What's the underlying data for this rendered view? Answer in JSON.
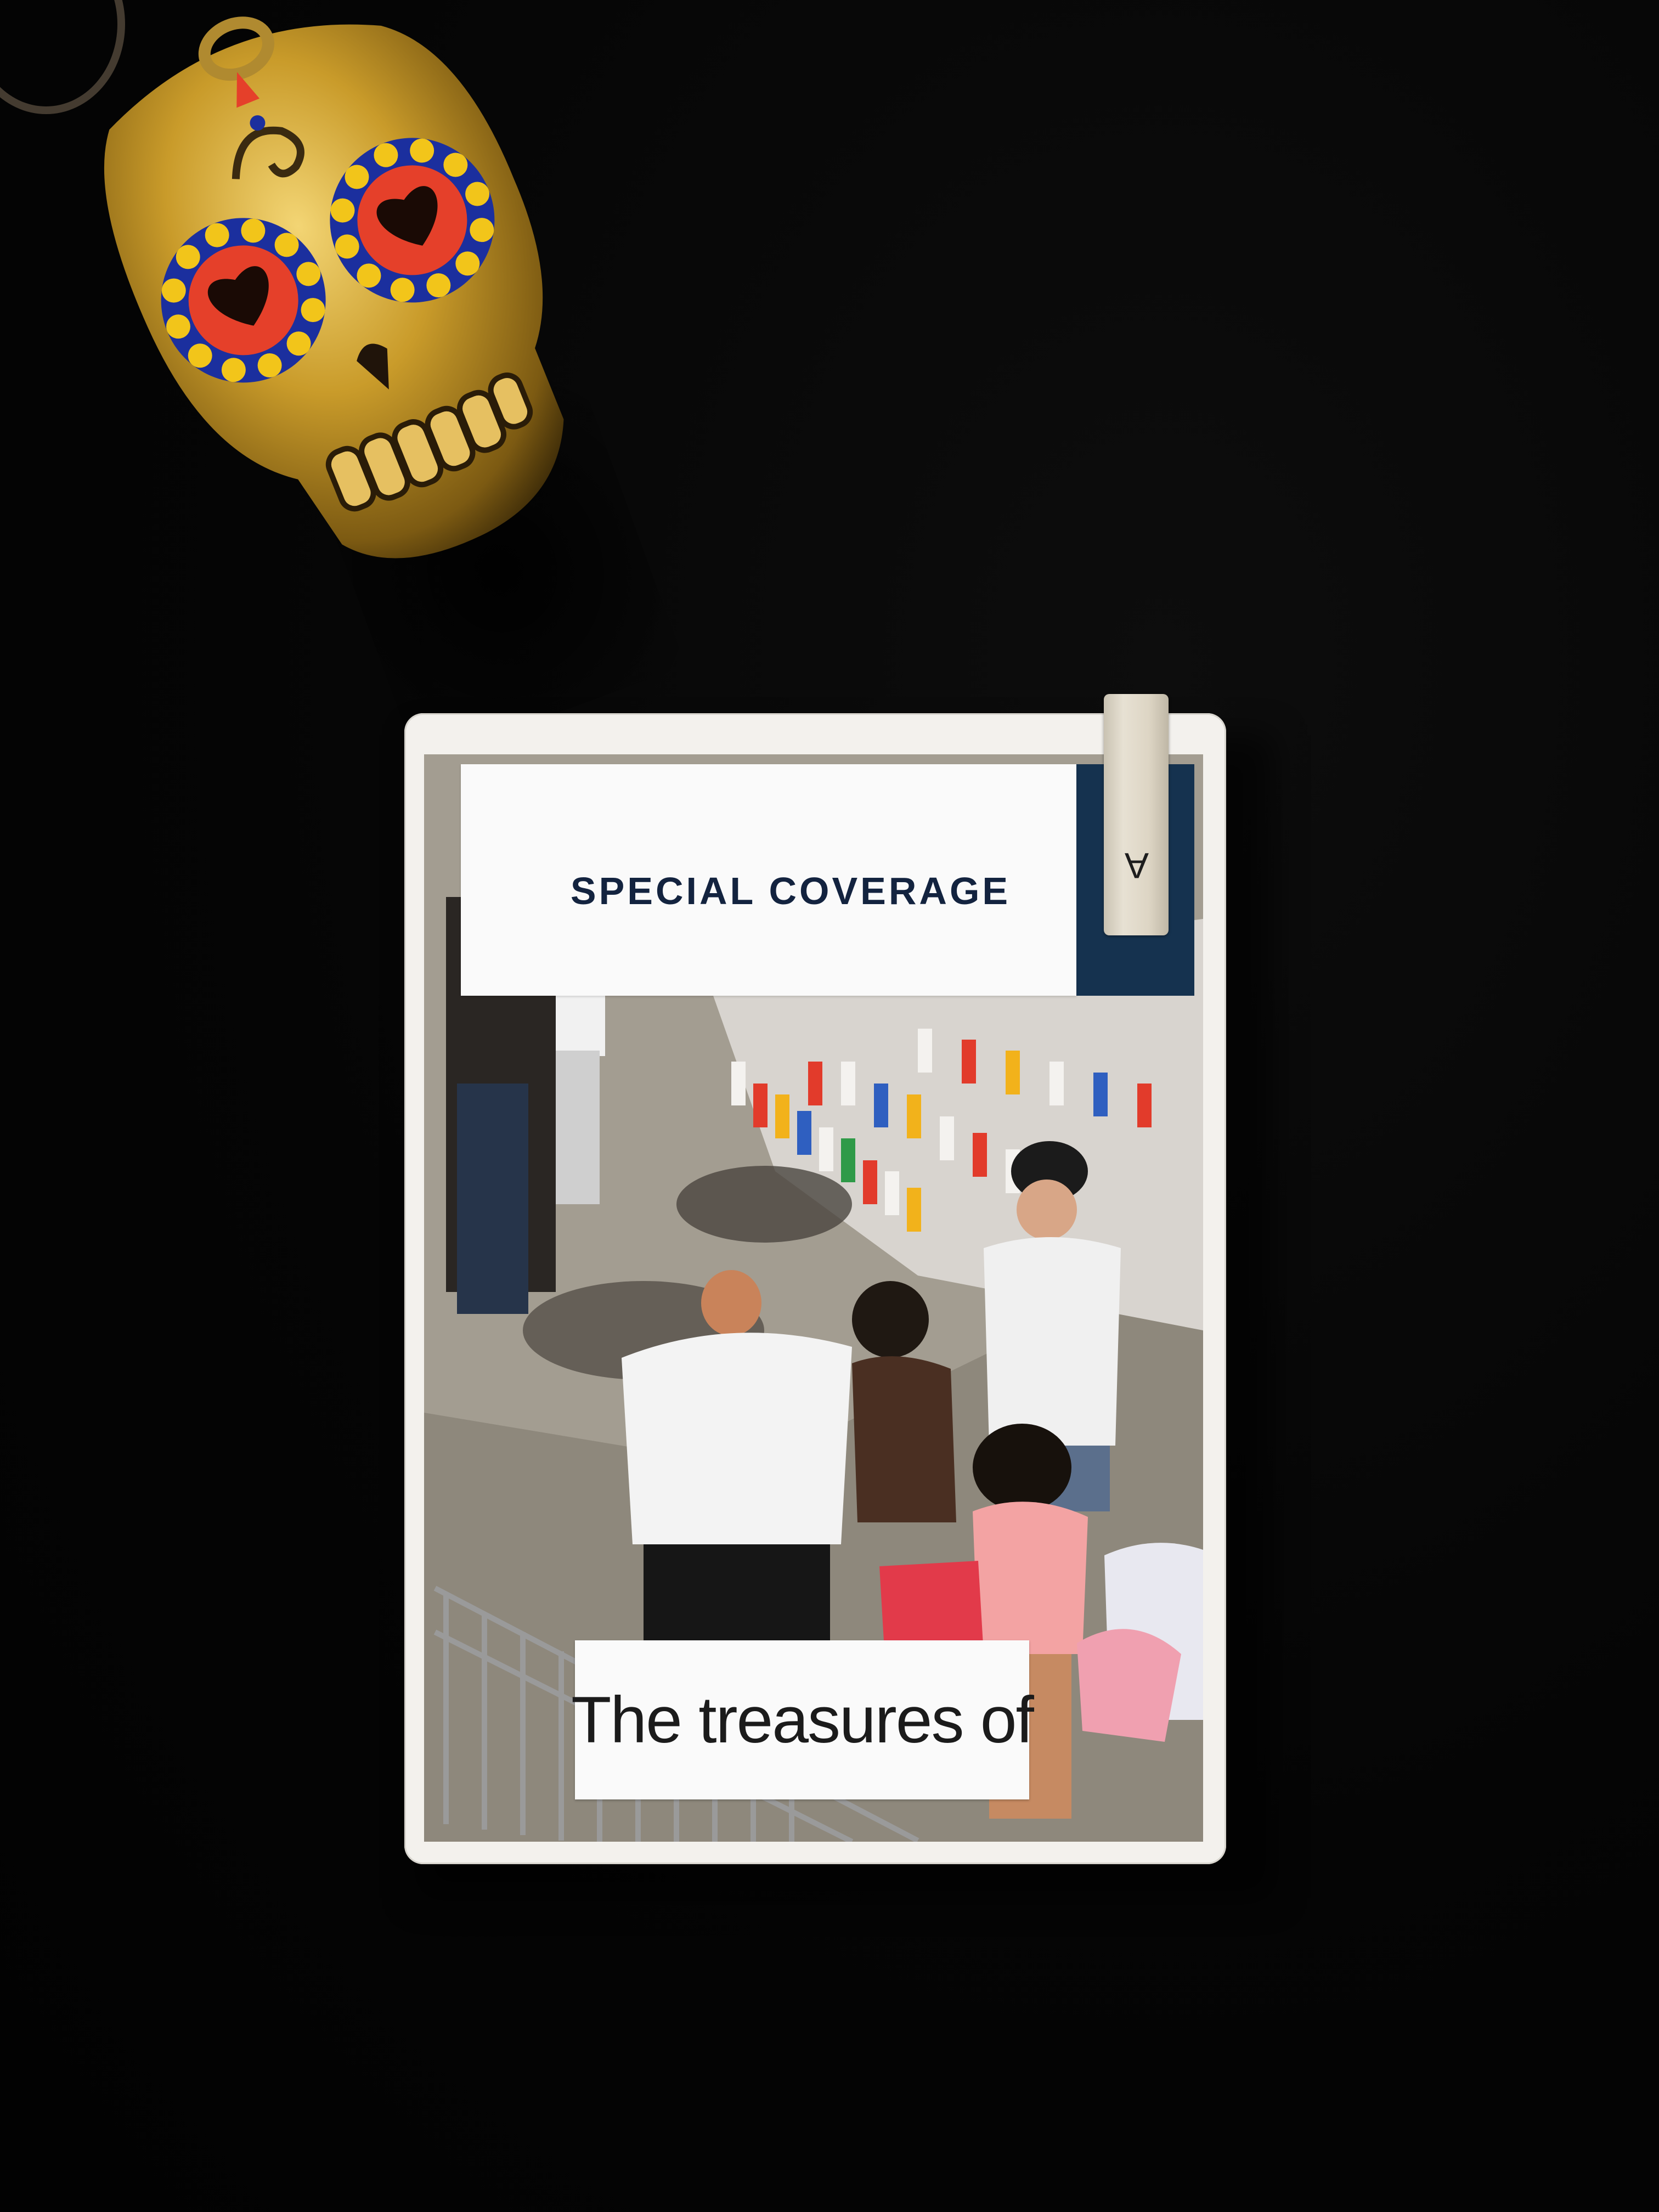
{
  "card": {
    "title": "SPECIAL COVERAGE",
    "corner_letter": "A",
    "caption": "The treasures of"
  },
  "colors": {
    "background": "#050505",
    "skull_gold": "#c9a233",
    "title_navy": "#13233f",
    "navy_block": "#15324f",
    "card_white": "#f3f1ed"
  }
}
